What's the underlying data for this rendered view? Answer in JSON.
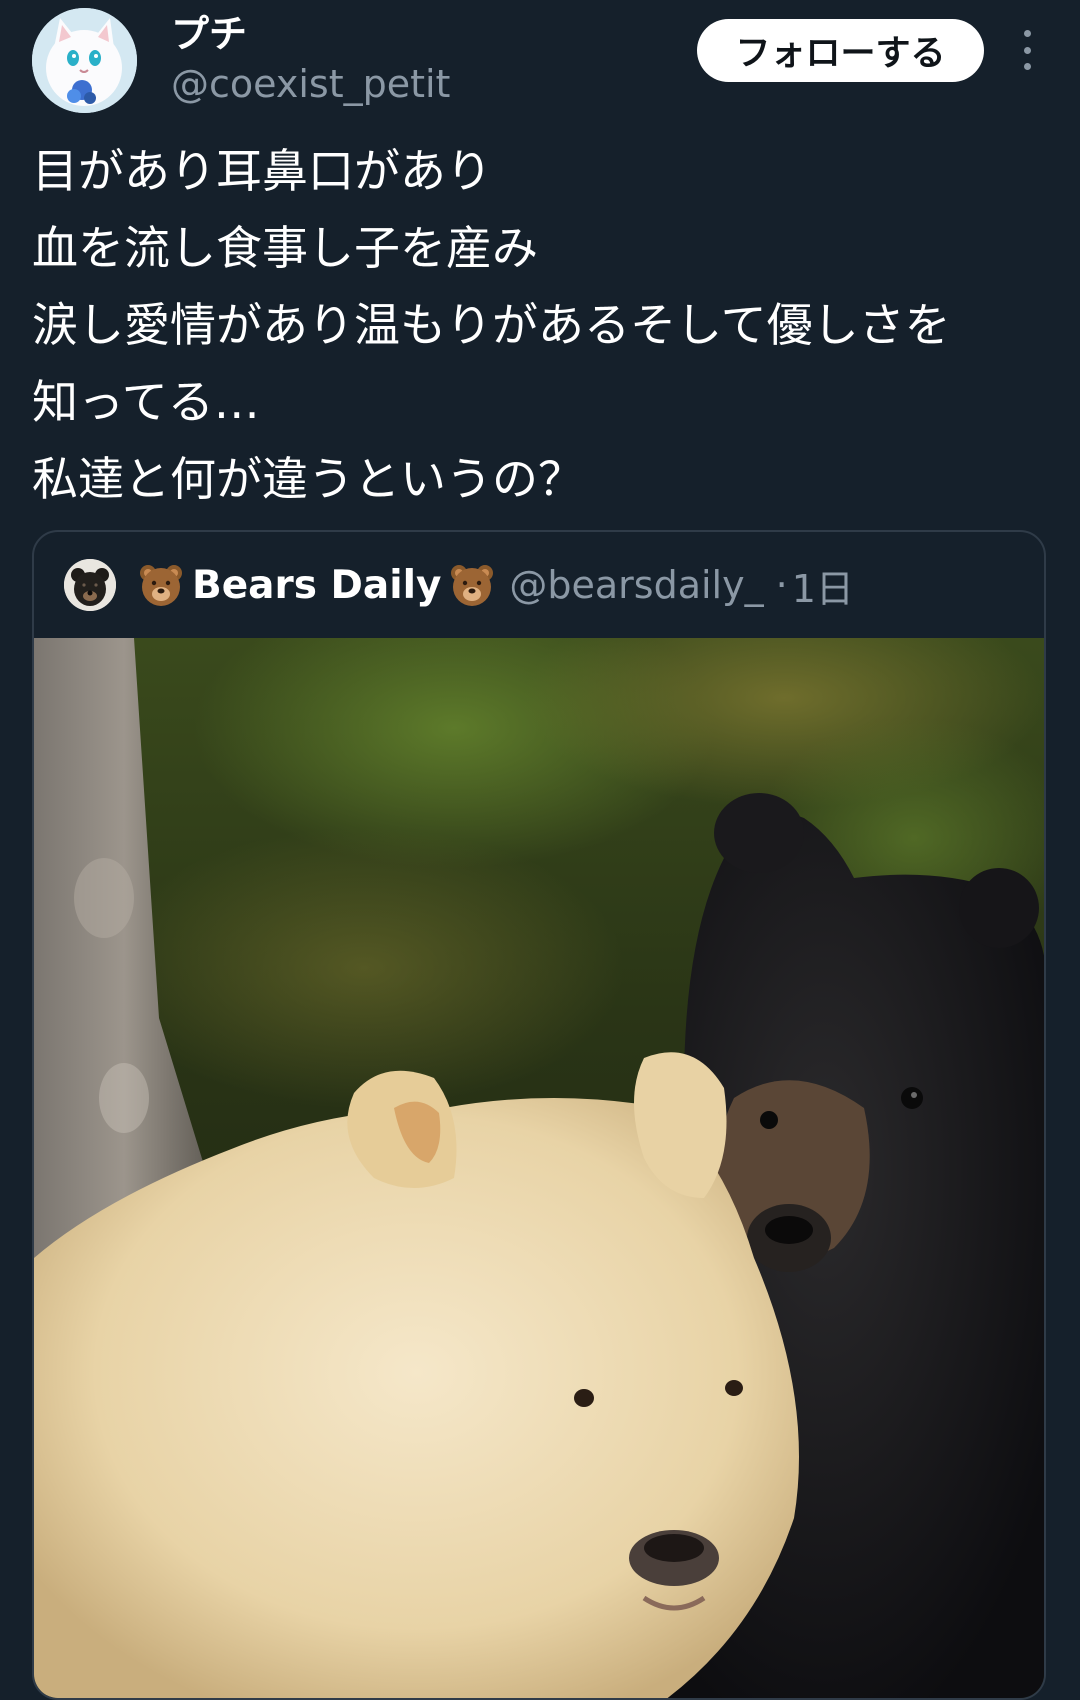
{
  "author": {
    "display_name": "プチ",
    "handle": "@coexist_petit",
    "avatar_icon": "cat-avatar-icon"
  },
  "actions": {
    "follow_label": "フォローする",
    "more_icon": "more-vertical-icon"
  },
  "tweet": {
    "lines": [
      "目があり耳鼻口があり",
      "血を流し食事し子を産み",
      "涙し愛情があり温もりがあるそして優しさを",
      "知ってる…",
      "私達と何が違うというの？"
    ]
  },
  "quote": {
    "display_name": "Bears Daily",
    "handle": "@bearsdaily_",
    "separator": "·",
    "time": "1日",
    "avatar_icon": "bear-avatar-icon",
    "emoji_icon": "bear-face-icon",
    "image_icon": "bears-photo-icon"
  },
  "colors": {
    "background": "#15202b",
    "text": "#ffffff",
    "secondary_text": "#8b98a5",
    "card_border": "#2f3b48",
    "follow_bg": "#ffffff"
  }
}
